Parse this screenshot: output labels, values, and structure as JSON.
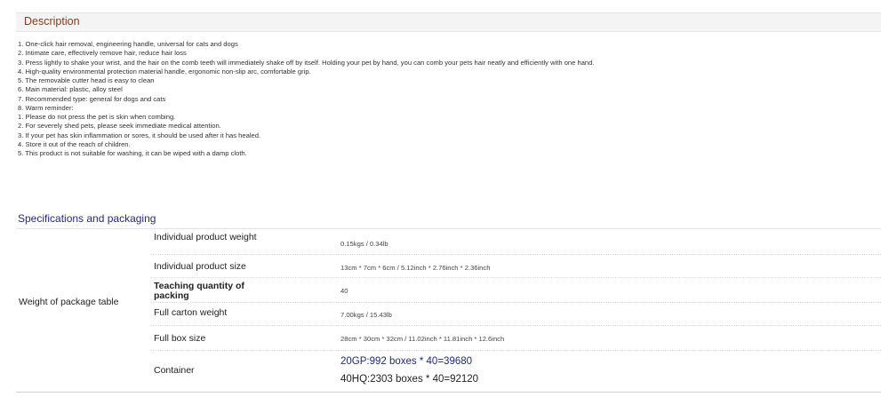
{
  "description": {
    "title": "Description",
    "lines": [
      "1. One-click hair removal, engineering handle, universal for cats and dogs",
      "2. Intimate care, effectively remove hair, reduce hair loss",
      "3. Press lightly to shake your wrist, and the hair on the comb teeth will immediately shake off by itself. Holding your pet by hand, you can comb your pets hair neatly and efficiently with one hand.",
      "4. High-quality environmental protection material handle, ergonomic non-slip arc, comfortable grip.",
      "5. The removable cutter head is easy to clean",
      "6. Main material: plastic, alloy steel",
      "7. Recommended type: general for dogs and cats",
      "8. Warm reminder:",
      "1. Please do not press the pet is skin when combing.",
      "2. For severely shed pets, please seek immediate medical attention.",
      "3. If your pet has skin inflammation or sores, it should be used after it has healed.",
      "4. Store it out of the reach of children.",
      "5. This product is not suitable for washing, it can be wiped with a damp cloth."
    ]
  },
  "specs": {
    "title": "Specifications and packaging",
    "group_label": "Weight of package table",
    "rows": [
      {
        "label": "Individual product weight",
        "value": "0.15kgs / 0.34lb"
      },
      {
        "label": "Individual product size",
        "value": "13cm * 7cm * 6cm / 5.12inch * 2.76inch * 2.36inch"
      },
      {
        "label": "Teaching quantity of packing",
        "value": "40"
      },
      {
        "label": "Full carton weight",
        "value": "7.00kgs / 15.43lb"
      },
      {
        "label": "Full box size",
        "value": "28cm * 30cm * 32cm / 11.02inch * 11.81inch * 12.6inch"
      },
      {
        "label": "Container",
        "value_1": "20GP:992 boxes * 40=39680",
        "value_2": "40HQ:2303 boxes * 40=92120"
      }
    ]
  }
}
